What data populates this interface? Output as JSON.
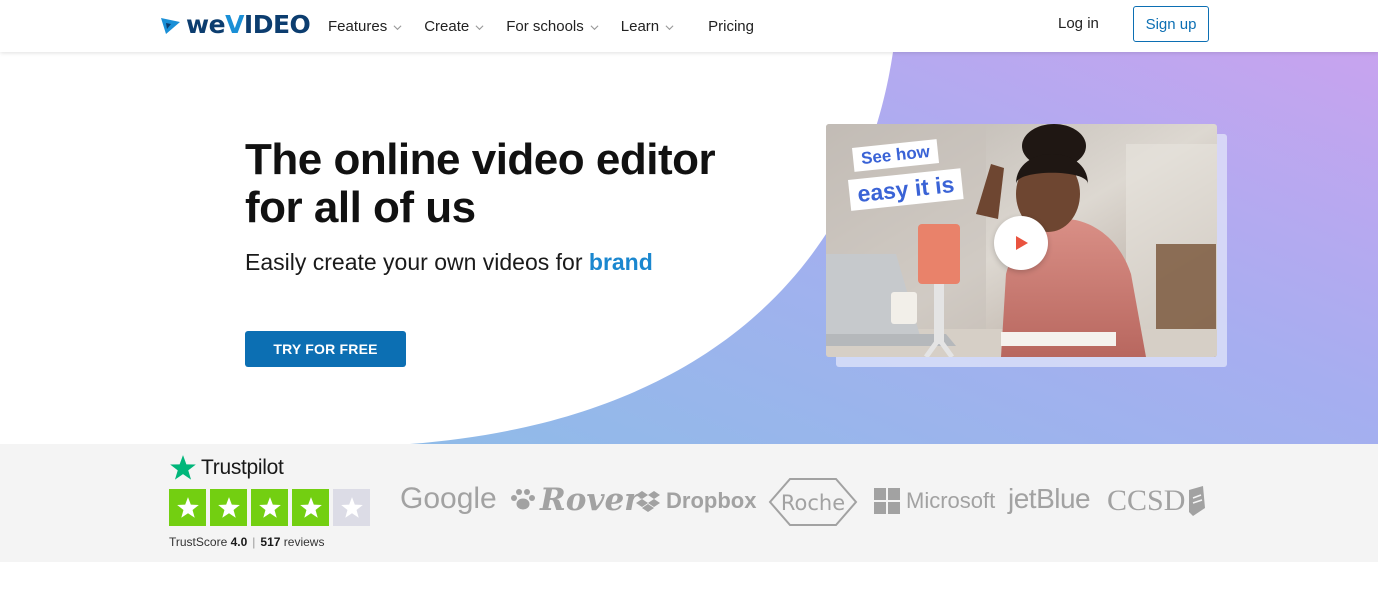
{
  "nav": {
    "logo_text_we": "we",
    "logo_text_v": "V",
    "logo_text_rest": "IDEO",
    "items": [
      {
        "label": "Features",
        "dropdown": true
      },
      {
        "label": "Create",
        "dropdown": true
      },
      {
        "label": "For schools",
        "dropdown": true
      },
      {
        "label": "Learn",
        "dropdown": true
      },
      {
        "label": "Pricing",
        "dropdown": false
      }
    ],
    "login": "Log in",
    "signup": "Sign up"
  },
  "hero": {
    "headline": "The online video editor for all of us",
    "subline_prefix": "Easily create your own videos for ",
    "subline_highlight": "brand",
    "cta": "TRY FOR FREE",
    "video": {
      "sticker_line1": "See how",
      "sticker_line2": "easy it is",
      "play_icon": "play-icon"
    }
  },
  "trustpilot": {
    "name": "Trustpilot",
    "rating": 4,
    "max_rating": 5,
    "score_label": "TrustScore",
    "score_value": "4.0",
    "reviews_count": "517",
    "reviews_label": "reviews"
  },
  "brands": {
    "google": "Google",
    "rover": "Rover",
    "dropbox": "Dropbox",
    "roche": "Roche",
    "microsoft": "Microsoft",
    "jetblue": "jetBlue",
    "ccsd": "CCSD"
  },
  "colors": {
    "primary": "#0c6fb3",
    "highlight": "#1a87cf",
    "trustpilot_green": "#00b67a",
    "gradient_start": "#8fb6ea",
    "gradient_end": "#c5a4ee"
  }
}
